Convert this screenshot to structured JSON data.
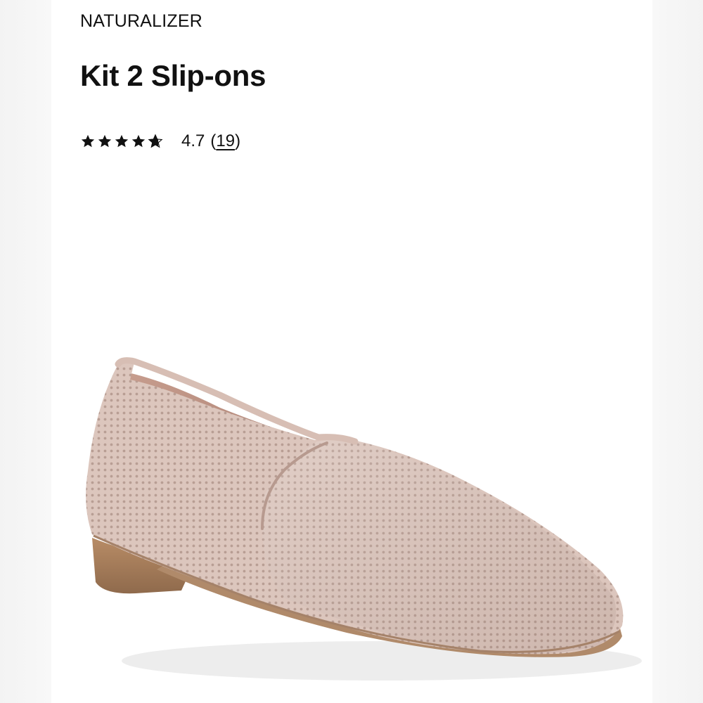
{
  "product": {
    "brand": "NATURALIZER",
    "title": "Kit 2 Slip-ons",
    "rating": {
      "stars_filled": 4.7,
      "stars_total": 5,
      "value": "4.7",
      "review_count": "19",
      "paren_open": "(",
      "paren_close": ")"
    },
    "image": {
      "description_icon": "shoe-product-image"
    }
  },
  "colors": {
    "text": "#111111",
    "background": "#ffffff",
    "shoe_knit": "#dcc6bd",
    "sole": "#a27b5a"
  }
}
